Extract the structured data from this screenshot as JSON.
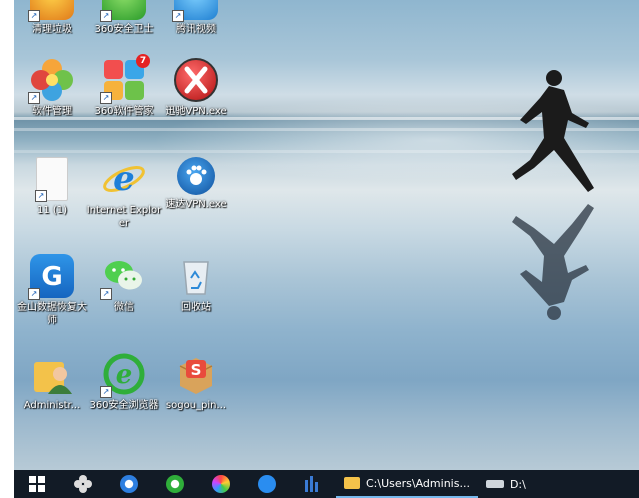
{
  "desktop": {
    "icons": [
      {
        "label": "清理垃圾",
        "shortcut": true
      },
      {
        "label": "360安全卫士",
        "shortcut": true
      },
      {
        "label": "腾讯视频",
        "shortcut": true
      },
      {
        "label": "软件管理",
        "shortcut": true
      },
      {
        "label": "360软件管家",
        "shortcut": true,
        "badge": "7"
      },
      {
        "label": "迅驰VPN.exe",
        "shortcut": false
      },
      {
        "label": "11 (1)",
        "shortcut": true
      },
      {
        "label": "Internet Explorer",
        "shortcut": false
      },
      {
        "label": "速达VPN.exe",
        "shortcut": false
      },
      {
        "label": "金山数据恢复大师",
        "shortcut": true
      },
      {
        "label": "微信",
        "shortcut": true
      },
      {
        "label": "回收站",
        "shortcut": false
      },
      {
        "label": "Administr...",
        "shortcut": false
      },
      {
        "label": "360安全浏览器",
        "shortcut": true
      },
      {
        "label": "sogou_pin...",
        "shortcut": false
      }
    ]
  },
  "taskbar": {
    "folder1": "C:\\Users\\Adminis...",
    "folder2": "D:\\"
  },
  "colors": {
    "taskbar": "#121b26",
    "label_text": "#ffffff",
    "active_underline": "#76b9ed"
  }
}
